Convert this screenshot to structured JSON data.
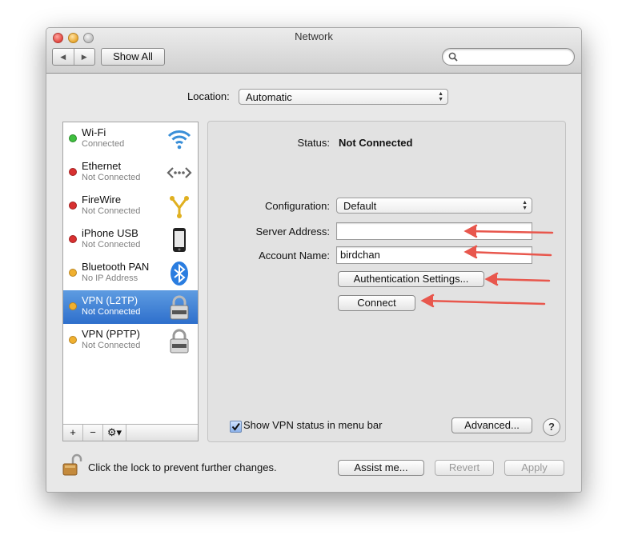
{
  "window": {
    "title": "Network"
  },
  "toolbar": {
    "back": "◀",
    "forward": "▶",
    "show_all": "Show All",
    "search_placeholder": ""
  },
  "location": {
    "label": "Location:",
    "value": "Automatic"
  },
  "services": [
    {
      "name": "Wi-Fi",
      "status": "Connected",
      "dot": "#3fbf3f",
      "icon": "wifi-icon"
    },
    {
      "name": "Ethernet",
      "status": "Not Connected",
      "dot": "#d83030",
      "icon": "ethernet-icon"
    },
    {
      "name": "FireWire",
      "status": "Not Connected",
      "dot": "#d83030",
      "icon": "firewire-icon"
    },
    {
      "name": "iPhone USB",
      "status": "Not Connected",
      "dot": "#d83030",
      "icon": "iphone-icon"
    },
    {
      "name": "Bluetooth PAN",
      "status": "No IP Address",
      "dot": "#f0b030",
      "icon": "bluetooth-icon"
    },
    {
      "name": "VPN (L2TP)",
      "status": "Not Connected",
      "dot": "#f0b030",
      "icon": "vpn-lock-icon",
      "selected": true
    },
    {
      "name": "VPN (PPTP)",
      "status": "Not Connected",
      "dot": "#f0b030",
      "icon": "vpn-lock-icon"
    }
  ],
  "sidebar_controls": {
    "add": "+",
    "remove": "−",
    "action": "⚙▾"
  },
  "detail": {
    "status_label": "Status:",
    "status_value": "Not Connected",
    "configuration_label": "Configuration:",
    "configuration_value": "Default",
    "server_address_label": "Server Address:",
    "server_address_value": "",
    "account_name_label": "Account Name:",
    "account_name_value": "birdchan",
    "auth_settings_button": "Authentication Settings...",
    "connect_button": "Connect",
    "show_vpn_status_label": "Show VPN status in menu bar",
    "show_vpn_status_checked": true,
    "advanced_button": "Advanced...",
    "help_button": "?"
  },
  "footer": {
    "lock_text": "Click the lock to prevent further changes.",
    "assist_button": "Assist me...",
    "revert_button": "Revert",
    "apply_button": "Apply"
  },
  "colors": {
    "annotation_arrow": "#e8574d",
    "selection": "#3a7bd5"
  }
}
